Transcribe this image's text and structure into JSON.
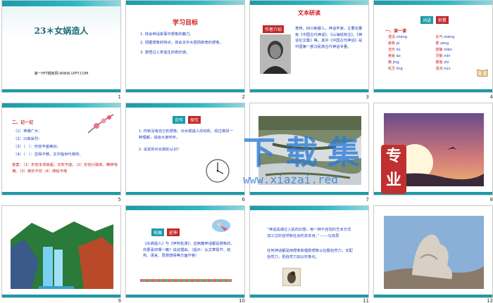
{
  "slides": [
    {
      "num": "1",
      "title": "23＊女娲造人",
      "sub": "第一PPT模板网-WWW.1PPT.COM"
    },
    {
      "num": "2",
      "heading": "学习目标",
      "items": [
        "1. 体会神话故事中想象的魅力。",
        "2. 把握想象的特点，体会文中大胆而新奇的想象。",
        "3. 感悟过人类诞生的奇妙感。"
      ]
    },
    {
      "num": "3",
      "heading": "文本研读",
      "tag": "作者介绍",
      "body": "袁珂，四川新都人，神话学家。主要论著有《中国古代神话》、《山海经校注》、《神话论文集》等。其中《中国古代神话》是中国第一部汉民族古代神话专著。"
    },
    {
      "num": "4",
      "tag1": "词语",
      "tag2": "积累",
      "sec": "一、读一读",
      "words": [
        [
          "澄清",
          "chéng"
        ],
        [
          "失气",
          "shēng"
        ],
        [
          "疲惫",
          "pí"
        ],
        [
          "葬",
          "zàng"
        ],
        [
          "流光",
          "liú"
        ],
        [
          "醇静",
          "shēn"
        ],
        [
          "奥秘",
          "ào"
        ],
        [
          "灵敏",
          "mǐn"
        ],
        [
          "精",
          "jīng"
        ],
        [
          "繁殖",
          "zhí"
        ],
        [
          "机灵",
          "líng"
        ],
        [
          "混沌",
          "hùn"
        ]
      ]
    },
    {
      "num": "5",
      "sec": "二、记一记",
      "lines": [
        "（1）神通广大：",
        "（2）兴高采烈：",
        "（3）（　）：形容丰富美好。",
        "（4）（　）：显得不够，文中指世代相传。"
      ],
      "answer": "答案：（1）形容本领高超，无所不能；（2）形容兴致高，精神饱满。（3）奥妙不穷（4）绵延不绝"
    },
    {
      "num": "6",
      "tag1": "合作",
      "tag2": "探究",
      "items": [
        "1. 你有没有自己的想象，对女娲造人的动机、经过做另一种理解，说给大家听听。",
        "2. 说说你对女娲的认识？"
      ]
    },
    {
      "num": "7"
    },
    {
      "num": "8"
    },
    {
      "num": "9"
    },
    {
      "num": "10",
      "tag1": "拓展",
      "tag2": "延伸",
      "body": "《女娲造人》与《伊阿佐漫》，这两篇神话都是想象的，你更喜欢哪一篇？说说理由。（提示：从文章情节、结构、语言、思想感情等方面作答）"
    },
    {
      "num": "11",
      "quote": "“神话是通过人民的幻想，用一种不自觉的艺术方式加工过的自然和社会形态本身。” ——马克思",
      "body": "任何神话都是用想象和借助想象以征服自然力，支配自然力，把自然力加以形象化。"
    },
    {
      "num": "12"
    }
  ],
  "watermark": {
    "cn": "下载集",
    "tag1": "专",
    "tag2": "业",
    "url": "www.xiazai.red"
  },
  "colors": {
    "accent": "#1c9aa8",
    "red": "#d02020",
    "blue": "#2040c0",
    "watermark": "#2a7bd8"
  }
}
